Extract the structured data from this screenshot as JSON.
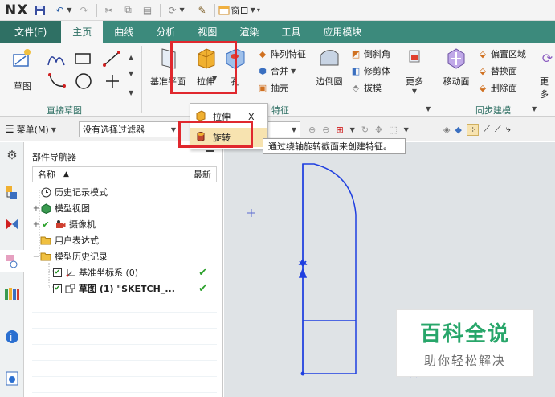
{
  "app": {
    "logo": "NX",
    "window_menu": "窗口"
  },
  "tabs": [
    {
      "label": "文件(F)"
    },
    {
      "label": "主页"
    },
    {
      "label": "曲线"
    },
    {
      "label": "分析"
    },
    {
      "label": "视图"
    },
    {
      "label": "渲染"
    },
    {
      "label": "工具"
    },
    {
      "label": "应用模块"
    }
  ],
  "ribbon": {
    "sketch_label": "草图",
    "direct_sketch_group": "直接草图",
    "datum_label": "基准平面",
    "extrude_label": "拉伸",
    "hole_label": "孔",
    "feature_group": "特征",
    "pattern_feature": "阵列特征",
    "unite": "合并",
    "shell": "抽壳",
    "edge_blend": "边倒圆",
    "chamfer": "倒斜角",
    "trim_body": "修剪体",
    "draft": "拔模",
    "more_label": "更多",
    "move_face": "移动面",
    "offset_region": "偏置区域",
    "replace_face": "替换面",
    "delete_face": "删除面",
    "sync_group": "同步建模",
    "more2_label": "更多"
  },
  "toolbar": {
    "menu_label": "菜单(M)",
    "filter_placeholder": "没有选择过滤器"
  },
  "dropdown": {
    "item1": "拉伸",
    "item1_shortcut": "X",
    "item2": "旋转"
  },
  "tooltip": "通过绕轴旋转截面来创建特征。",
  "navigator": {
    "title": "部件导航器",
    "col_name": "名称",
    "col_latest": "最新",
    "rows": [
      {
        "label": "历史记录模式"
      },
      {
        "label": "模型视图"
      },
      {
        "label": "摄像机"
      },
      {
        "label": "用户表达式"
      },
      {
        "label": "模型历史记录"
      },
      {
        "label": "基准坐标系 (0)"
      },
      {
        "label": "草图 (1) \"SKETCH_..."
      }
    ]
  },
  "watermark": {
    "main": "百科全说",
    "sub": "助你轻松解决"
  },
  "colors": {
    "ribbon_tab_bg": "#3c8a7c",
    "accent": "#2f7064",
    "highlight_box": "#e0282e",
    "sketch_line": "#1f3fe0",
    "check_green": "#2aa02a"
  }
}
